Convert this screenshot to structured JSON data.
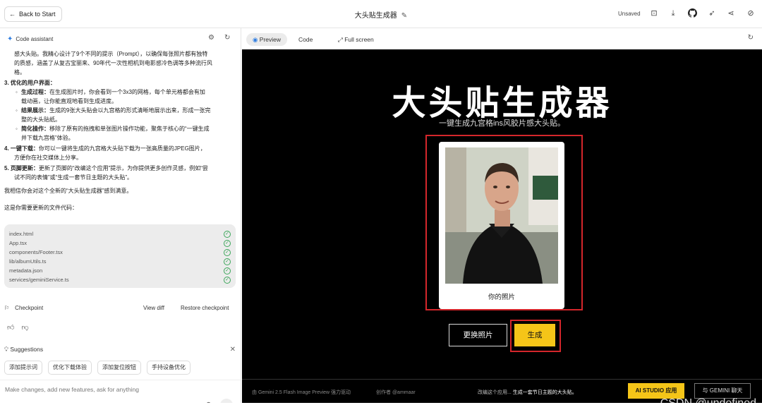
{
  "topbar": {
    "back_label": "Back to Start",
    "app_title": "大头贴生成器",
    "status": "Unsaved"
  },
  "assistant": {
    "title": "Code assistant",
    "paragraphs": [
      "感大头贴。我精心设计了9个不同的提示（Prompt），以确保每张照片都有独特",
      "的质感，涵盖了从复古宝丽来、90年代一次性相机到电影感冷色调等多种流行风",
      "格。"
    ],
    "item3_title": "3. 优化的用户界面：",
    "item3_subs": [
      {
        "bold": "生成过程：",
        "text": "在生成图片时，你会看到一个3x3的网格，每个单元格都会有加",
        "cont": "载动画，让你能直观地看到生成进度。"
      },
      {
        "bold": "结果展示：",
        "text": "生成的9张大头贴会以九宫格的形式清晰地展示出来，形成一张完",
        "cont": "整的大头贴纸。"
      },
      {
        "bold": "简化操作：",
        "text": "移除了原有的拖拽和单张图片操作功能，聚焦于核心的“一键生成",
        "cont": "并下载九宫格”体验。"
      }
    ],
    "item4": {
      "bold": "4. 一键下载：",
      "text": "你可以一键将生成的九宫格大头贴下载为一张高质量的JPEG图片，",
      "cont": "方便你在社交媒体上分享。"
    },
    "item5": {
      "bold": "5. 页脚更新：",
      "text": "更新了页脚的“改编这个应用”提示，为你提供更多创作灵感，例如“尝",
      "cont": "试不同的表情”或“生成一套节日主题的大头贴”。"
    },
    "closing": "我相信你会对这个全新的“大头贴生成器”感到满意。",
    "files_intro": "这是你需要更新的文件代码：",
    "files": [
      "index.html",
      "App.tsx",
      "components/Footer.tsx",
      "lib/albumUtils.ts",
      "metadata.json",
      "services/geminiService.ts"
    ],
    "checkpoint_label": "Checkpoint",
    "view_diff": "View diff",
    "restore_checkpoint": "Restore checkpoint",
    "suggestions_label": "Suggestions",
    "suggestions": [
      "添加提示词",
      "优化下载体验",
      "添加复位按钮",
      "手持设备优化"
    ],
    "input_placeholder": "Make changes, add new features, ask for anything"
  },
  "preview_tabs": {
    "preview": "Preview",
    "code": "Code",
    "fullscreen": "Full screen"
  },
  "app": {
    "heading": "大头贴生成器",
    "subheading": "一键生成九宫格ins风胶片感大头贴。",
    "photo_caption": "你的照片",
    "change_photo": "更换照片",
    "generate": "生成",
    "footer_powered": "由 Gemini 2.5 Flash Image Preview 强力驱动",
    "footer_author": "创作者 @ammaar",
    "footer_remix_prefix": "改编这个应用...",
    "footer_remix_idea": "生成一套节日主题的大头贴。",
    "studio_button": "AI STUDIO 应用",
    "gemini_button": "与 GEMINI 聊天"
  },
  "watermark": "CSDN @undefined",
  "colors": {
    "accent_yellow": "#f5c518",
    "highlight_red": "#d4262b",
    "check_green": "#3ca65a",
    "link_blue": "#2f7de1"
  }
}
